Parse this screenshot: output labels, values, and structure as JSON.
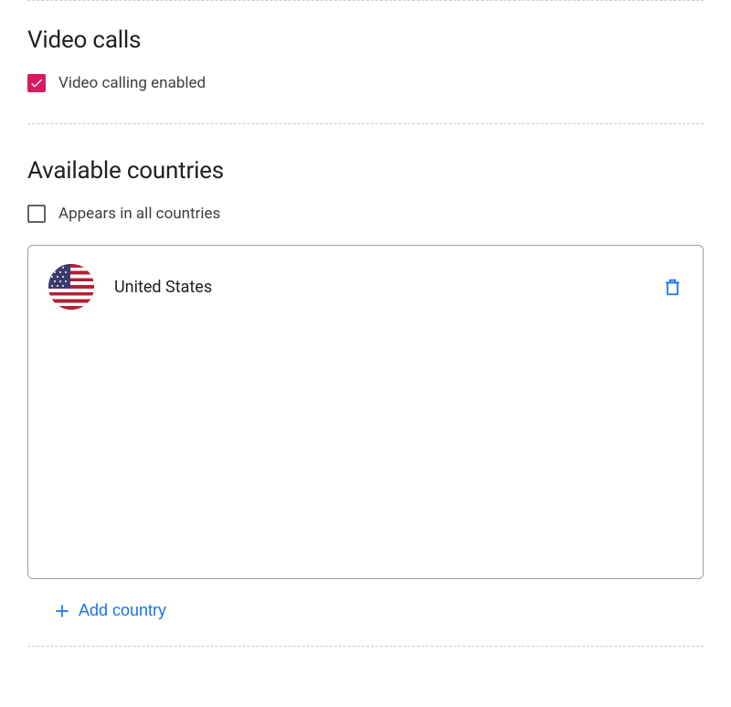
{
  "video_calls": {
    "title": "Video calls",
    "checkbox_label": "Video calling enabled",
    "checked": true
  },
  "available_countries": {
    "title": "Available countries",
    "checkbox_label": "Appears in all countries",
    "checked": false,
    "items": [
      {
        "name": "United States"
      }
    ],
    "add_label": "Add country"
  },
  "colors": {
    "accent": "#d81b60",
    "link": "#1a73e8"
  }
}
